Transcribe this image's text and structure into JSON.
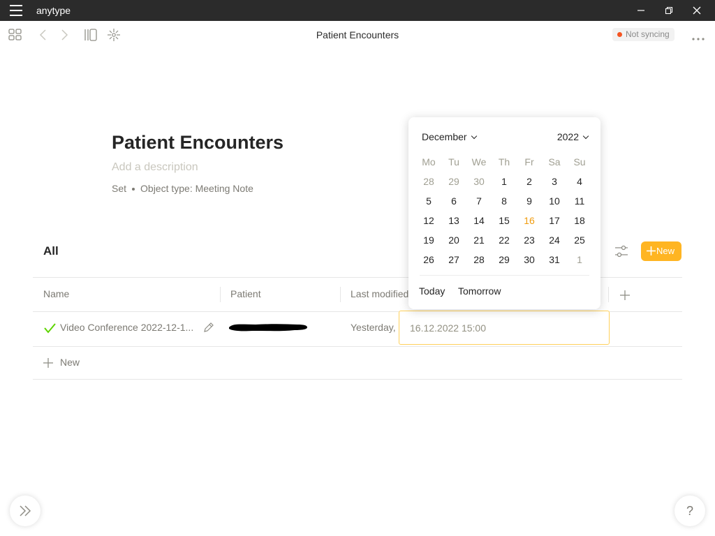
{
  "window": {
    "app_name": "anytype"
  },
  "toolbar": {
    "page_title": "Patient Encounters",
    "sync_status": "Not syncing",
    "sync_color": "#f55522"
  },
  "object": {
    "title": "Patient Encounters",
    "description_placeholder": "Add a description",
    "meta_type": "Set",
    "meta_object_type": "Object type: Meeting Note"
  },
  "view": {
    "title": "All",
    "new_label": "New",
    "accent": "#ffb522"
  },
  "table": {
    "columns": [
      "Name",
      "Patient",
      "Last modified"
    ],
    "rows": [
      {
        "name": "Video Conference 2022-12-1...",
        "patient": "",
        "last_modified": "Yesterday,",
        "date": "16.12.2022 15:00"
      }
    ],
    "add_row_label": "New"
  },
  "date_picker": {
    "month": "December",
    "year": "2022",
    "weekdays": [
      "Mo",
      "Tu",
      "We",
      "Th",
      "Fr",
      "Sa",
      "Su"
    ],
    "weeks": [
      [
        "28",
        "29",
        "30",
        "1",
        "2",
        "3",
        "4"
      ],
      [
        "5",
        "6",
        "7",
        "8",
        "9",
        "10",
        "11"
      ],
      [
        "12",
        "13",
        "14",
        "15",
        "16",
        "17",
        "18"
      ],
      [
        "19",
        "20",
        "21",
        "22",
        "23",
        "24",
        "25"
      ],
      [
        "26",
        "27",
        "28",
        "29",
        "30",
        "31",
        "1"
      ]
    ],
    "selected_day": "16",
    "today_label": "Today",
    "tomorrow_label": "Tomorrow"
  },
  "help": {
    "label": "?"
  }
}
